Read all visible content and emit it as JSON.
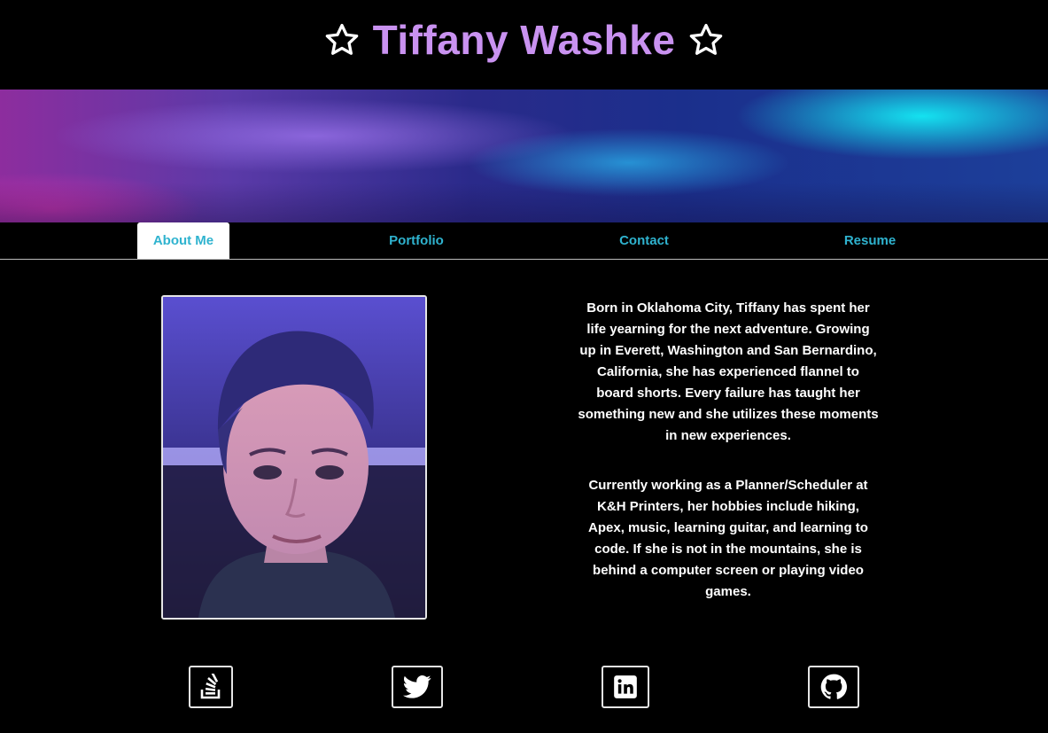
{
  "header": {
    "title": "Tiffany Washke",
    "left_icon": "star-outline-icon",
    "right_icon": "star-outline-icon",
    "title_color": "#c992f0"
  },
  "nav": {
    "tabs": [
      {
        "label": "About Me",
        "active": true
      },
      {
        "label": "Portfolio",
        "active": false
      },
      {
        "label": "Contact",
        "active": false
      },
      {
        "label": "Resume",
        "active": false
      }
    ],
    "link_color": "#2fb3cf"
  },
  "about": {
    "photo_alt": "Tiffany Washke portrait",
    "paragraphs": [
      "Born in Oklahoma City, Tiffany has spent her life yearning for the next adventure. Growing up in Everett, Washington and San Bernardino, California, she has experienced flannel to board shorts. Every failure has taught her something new and she utilizes these moments in new experiences.",
      "Currently working as a Planner/Scheduler at K&H Printers, her hobbies include hiking, Apex, music, learning guitar, and learning to code. If she is not in the mountains, she is behind a computer screen or playing video games."
    ]
  },
  "social": [
    {
      "name": "stack-overflow-icon"
    },
    {
      "name": "twitter-icon"
    },
    {
      "name": "linkedin-icon"
    },
    {
      "name": "github-icon"
    }
  ]
}
